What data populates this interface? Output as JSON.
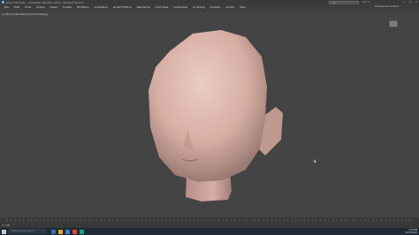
{
  "window": {
    "title": "Head 49 Amax - Autodesk 3ds Max 2018 - Student Version",
    "search_placeholder": "검색",
    "sign_in": "Sign In",
    "workspace": "Workspaces: Default",
    "controls": [
      "—",
      "□",
      "✕"
    ]
  },
  "menu": [
    "File",
    "Edit",
    "Tools",
    "Group",
    "Views",
    "Create",
    "Modifiers",
    "Animation",
    "Graph Editors",
    "Rendering",
    "Civil View",
    "Customize",
    "Scripting",
    "Content",
    "Arnold",
    "Help"
  ],
  "viewport": {
    "label": "[+] [Front] [Standard] [Default Shading]"
  },
  "status": {
    "text": "0 / 100"
  },
  "taskbar": {
    "search_placeholder": "Type here to search",
    "time": "4:38 PM",
    "date": "11/15/2018"
  },
  "colors": {
    "skin": "#d9b0a6",
    "viewport_bg": "#444444"
  }
}
